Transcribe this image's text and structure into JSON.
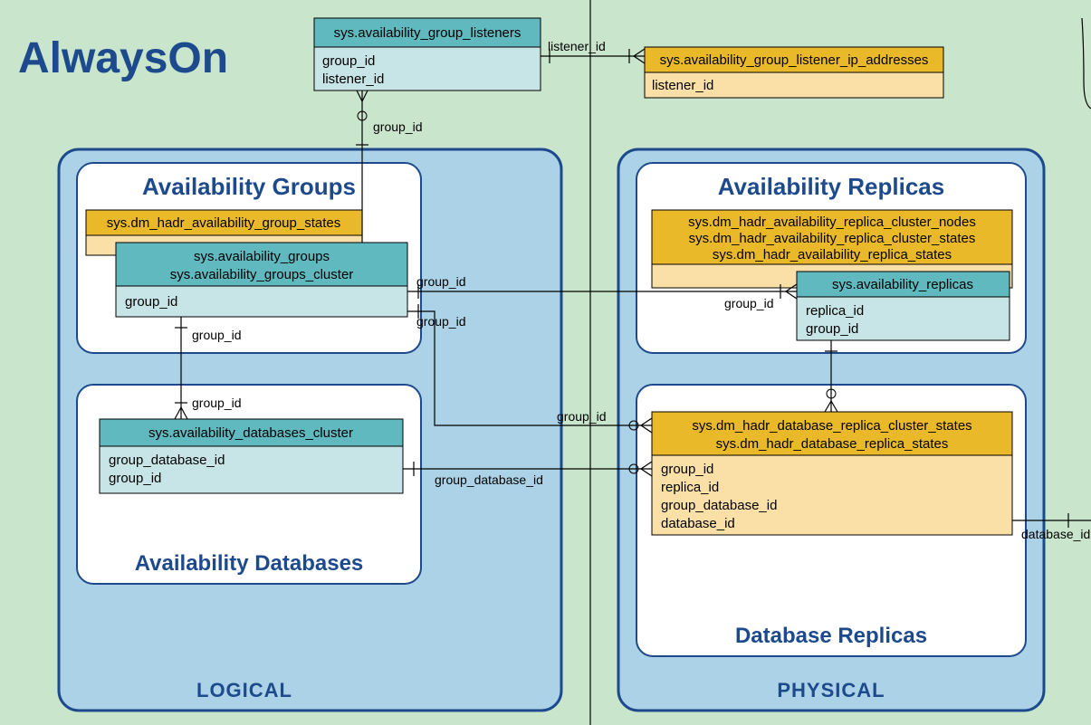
{
  "title": "AlwaysOn",
  "section_logical": "LOGICAL",
  "section_physical": "PHYSICAL",
  "groups": {
    "availability_groups": "Availability Groups",
    "availability_databases": "Availability Databases",
    "availability_replicas": "Availability Replicas",
    "database_replicas": "Database Replicas"
  },
  "entities": {
    "listeners": {
      "title": "sys.availability_group_listeners",
      "cols": [
        "group_id",
        "listener_id"
      ]
    },
    "listener_ips": {
      "title": "sys.availability_group_listener_ip_addresses",
      "cols": [
        "listener_id"
      ]
    },
    "ag_states": {
      "title": "sys.dm_hadr_availability_group_states"
    },
    "availability_groups": {
      "titles": [
        "sys.availability_groups",
        "sys.availability_groups_cluster"
      ],
      "cols": [
        "group_id"
      ]
    },
    "avail_db_cluster": {
      "title": "sys.availability_databases_cluster",
      "cols": [
        "group_database_id",
        "group_id"
      ]
    },
    "replica_dmvs": {
      "titles": [
        "sys.dm_hadr_availability_replica_cluster_nodes",
        "sys.dm_hadr_availability_replica_cluster_states",
        "sys.dm_hadr_availability_replica_states"
      ]
    },
    "availability_replicas": {
      "title": "sys.availability_replicas",
      "cols": [
        "replica_id",
        "group_id"
      ]
    },
    "db_replica_dmvs": {
      "titles": [
        "sys.dm_hadr_database_replica_cluster_states",
        "sys.dm_hadr_database_replica_states"
      ],
      "cols": [
        "group_id",
        "replica_id",
        "group_database_id",
        "database_id"
      ]
    }
  },
  "labels": {
    "listener_id": "listener_id",
    "group_id": "group_id",
    "group_database_id": "group_database_id",
    "database_id": "database_id"
  }
}
